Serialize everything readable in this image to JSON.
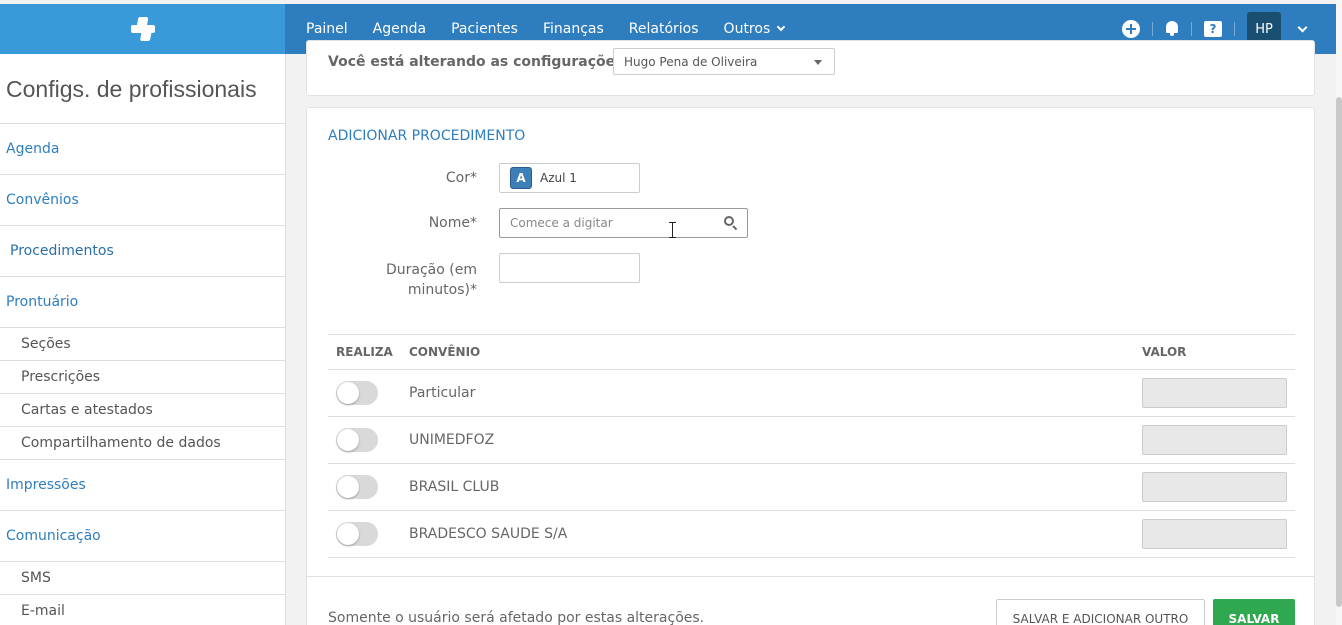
{
  "topbar": {
    "nav": [
      "Painel",
      "Agenda",
      "Pacientes",
      "Finanças",
      "Relatórios",
      "Outros"
    ],
    "avatar_initials": "HP",
    "icons": [
      "add-circle-icon",
      "bell-icon",
      "help-icon"
    ],
    "colors": {
      "bar": "#2e7dbf",
      "logo_area": "#3a9ad9",
      "avatar": "#1b4f72"
    }
  },
  "sidebar": {
    "title": "Configs. de profissionais",
    "items": [
      {
        "label": "Agenda",
        "type": "main"
      },
      {
        "label": "Convênios",
        "type": "main"
      },
      {
        "label": "Procedimentos",
        "type": "main",
        "active": true
      },
      {
        "label": "Prontuário",
        "type": "main"
      },
      {
        "label": "Seções",
        "type": "sub"
      },
      {
        "label": "Prescrições",
        "type": "sub"
      },
      {
        "label": "Cartas e atestados",
        "type": "sub"
      },
      {
        "label": "Compartilhamento de dados",
        "type": "sub"
      },
      {
        "label": "Impressões",
        "type": "main"
      },
      {
        "label": "Comunicação",
        "type": "main"
      },
      {
        "label": "SMS",
        "type": "sub"
      },
      {
        "label": "E-mail",
        "type": "sub"
      }
    ]
  },
  "settings_for": {
    "label": "Você está alterando as configurações de:",
    "selected": "Hugo Pena de Oliveira"
  },
  "form": {
    "section_title": "ADICIONAR PROCEDIMENTO",
    "cor_label": "Cor*",
    "cor_badge": "A",
    "cor_value": "Azul 1",
    "nome_label": "Nome*",
    "nome_placeholder": "Comece a digitar",
    "duracao_label_1": "Duração (em",
    "duracao_label_2": "minutos)*"
  },
  "table": {
    "headers": {
      "realiza": "REALIZA",
      "convenio": "CONVÊNIO",
      "valor": "VALOR"
    },
    "rows": [
      {
        "convenio": "Particular",
        "realiza": false
      },
      {
        "convenio": "UNIMEDFOZ",
        "realiza": false
      },
      {
        "convenio": "BRASIL CLUB",
        "realiza": false
      },
      {
        "convenio": "BRADESCO SAUDE S/A",
        "realiza": false
      }
    ]
  },
  "footer": {
    "note": "Somente o usuário será afetado por estas alterações.",
    "save_add_label": "SALVAR E ADICIONAR OUTRO",
    "save_label": "SALVAR",
    "save_color": "#2fa84f"
  }
}
